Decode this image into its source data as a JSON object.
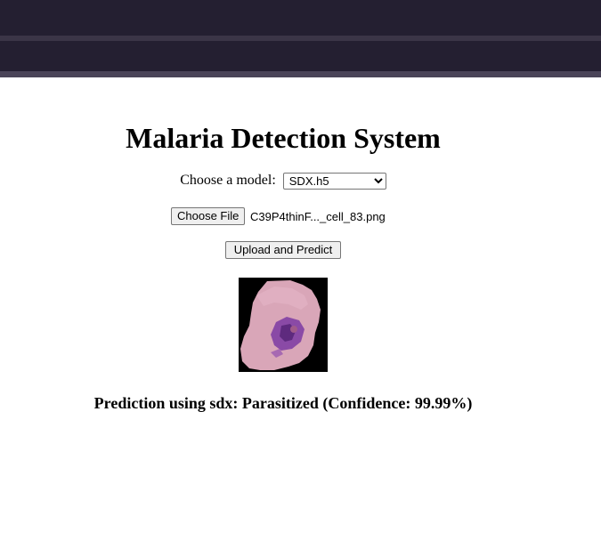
{
  "page": {
    "title": "Malaria Detection System"
  },
  "model": {
    "label": "Choose a model:",
    "selected": "SDX.h5"
  },
  "file": {
    "button_label": "Choose File",
    "file_name": "C39P4thinF..._cell_83.png"
  },
  "upload": {
    "button_label": "Upload and Predict"
  },
  "result": {
    "text": "Prediction using sdx: Parasitized (Confidence: 99.99%)"
  },
  "colors": {
    "top_bar": "#241f31",
    "cell_stain": "#d9a6b8",
    "parasite": "#7a3a9a"
  }
}
